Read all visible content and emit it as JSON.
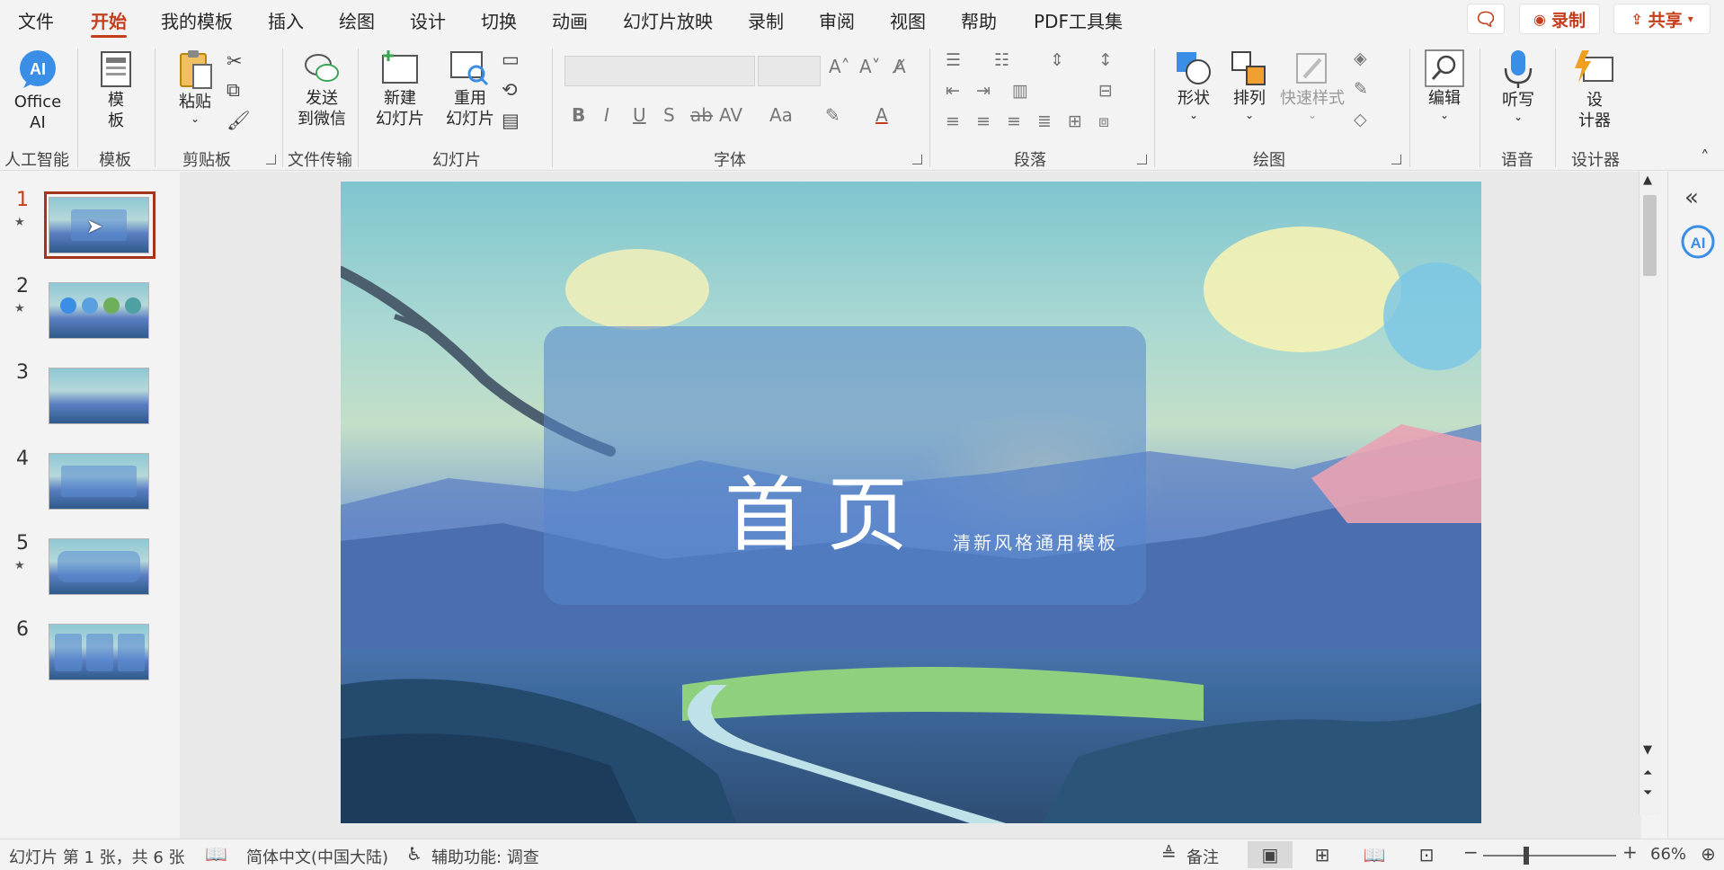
{
  "menu": {
    "items": [
      "文件",
      "开始",
      "我的模板",
      "插入",
      "绘图",
      "设计",
      "切换",
      "动画",
      "幻灯片放映",
      "录制",
      "审阅",
      "视图",
      "帮助",
      "PDF工具集"
    ],
    "active": "开始",
    "record_label": "录制",
    "share_label": "共享"
  },
  "ribbon": {
    "groups": {
      "ai": "人工智能",
      "templates": "模板",
      "clipboard": "剪贴板",
      "file_transfer": "文件传输",
      "slides": "幻灯片",
      "font": "字体",
      "paragraph": "段落",
      "drawing": "绘图",
      "voice": "语音",
      "designer": "设计器"
    },
    "buttons": {
      "office_ai": "Office\nAI",
      "template": "模\n板",
      "paste": "粘贴",
      "send_wechat": "发送\n到微信",
      "new_slide": "新建\n幻灯片",
      "reuse_slide": "重用\n幻灯片",
      "shapes": "形状",
      "arrange": "排列",
      "quick_styles": "快速样式",
      "edit": "编辑",
      "dictate": "听写",
      "designer": "设\n计器"
    },
    "font_format": [
      "B",
      "I",
      "U",
      "S",
      "ab",
      "AV",
      "Aa",
      "A"
    ]
  },
  "slides": {
    "numbers": [
      "1",
      "2",
      "3",
      "4",
      "5",
      "6"
    ],
    "selected": 1
  },
  "slide": {
    "title": "首页",
    "subtitle": "清新风格通用模板"
  },
  "status": {
    "slide_info": "幻灯片 第 1 张，共 6 张",
    "language": "简体中文(中国大陆)",
    "accessibility": "辅助功能: 调查",
    "notes": "备注",
    "zoom": "66%"
  },
  "colors": {
    "accent": "#c43e1c",
    "ai_blue": "#3a8ee6"
  }
}
